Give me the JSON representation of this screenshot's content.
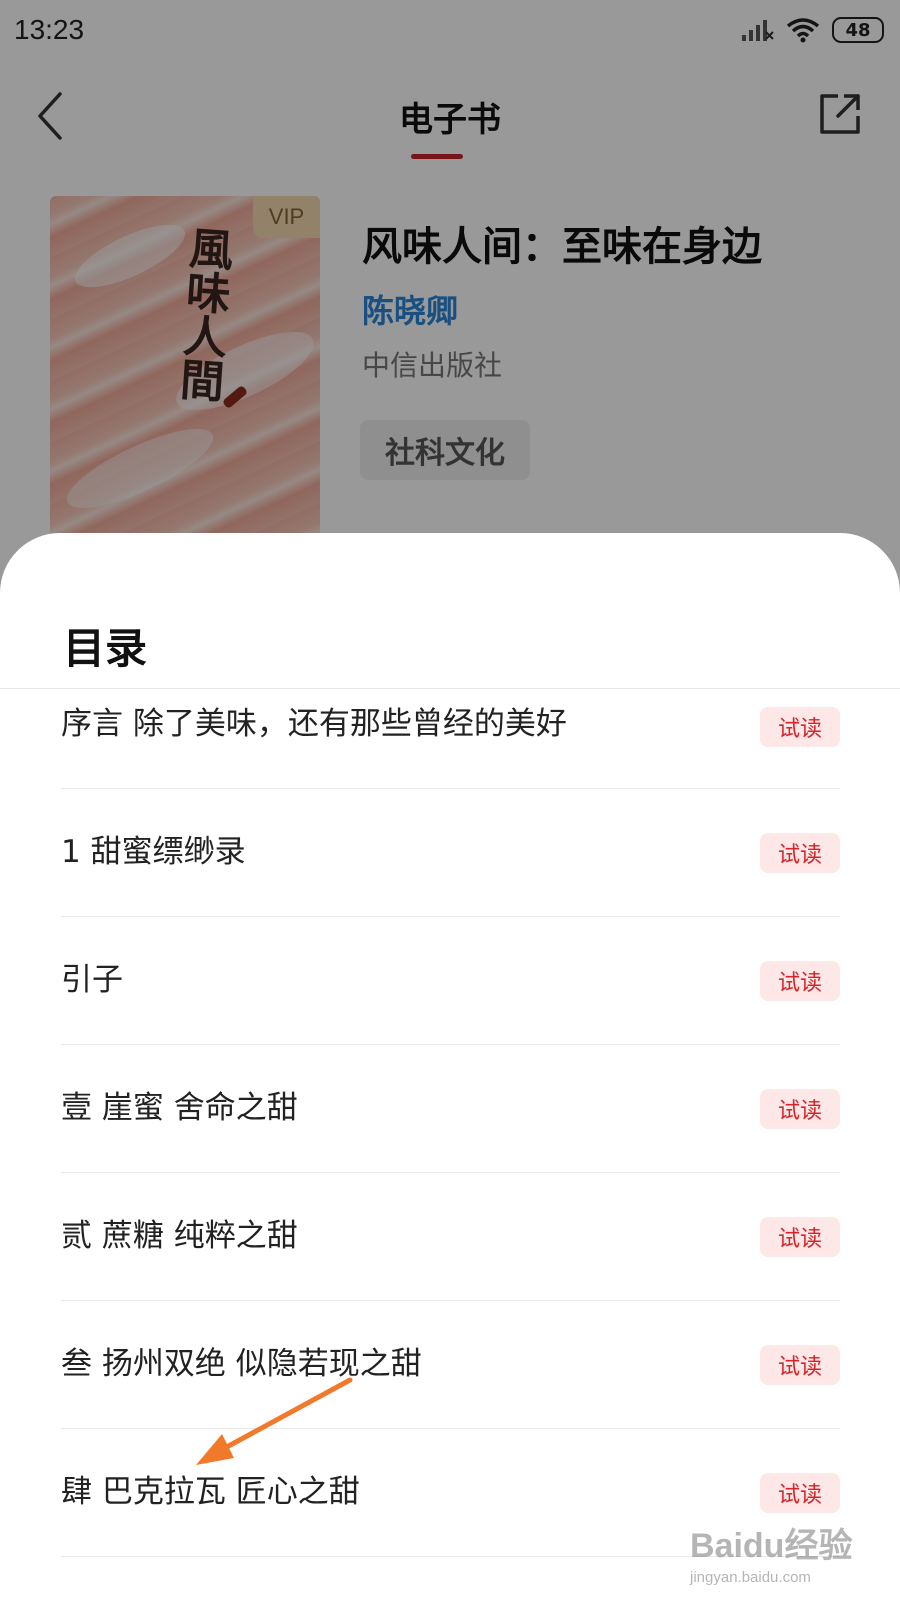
{
  "status_bar": {
    "time": "13:23",
    "battery": "48"
  },
  "nav": {
    "title": "电子书"
  },
  "book": {
    "cover_calligraphy": "風味人間",
    "vip_label": "VIP",
    "title": "风味人间：至味在身边",
    "author": "陈晓卿",
    "publisher": "中信出版社",
    "tag": "社科文化"
  },
  "toc": {
    "title": "目录",
    "trial_label": "试读",
    "items": [
      {
        "label": "序言 除了美味，还有那些曾经的美好"
      },
      {
        "label": "1 甜蜜缥缈录"
      },
      {
        "label": "引子"
      },
      {
        "label": "壹 崖蜜 舍命之甜"
      },
      {
        "label": "贰 蔗糖 纯粹之甜"
      },
      {
        "label": "叁 扬州双绝 似隐若现之甜"
      },
      {
        "label": "肆 巴克拉瓦 匠心之甜"
      }
    ]
  },
  "watermark": {
    "main": "Baidu经验",
    "sub": "jingyan.baidu.com"
  },
  "colors": {
    "accent_red": "#c8232c",
    "author_blue": "#2b86d8",
    "trial_bg": "#fde7e7",
    "trial_text": "#d6242a",
    "annotation_arrow": "#f07a2a"
  }
}
